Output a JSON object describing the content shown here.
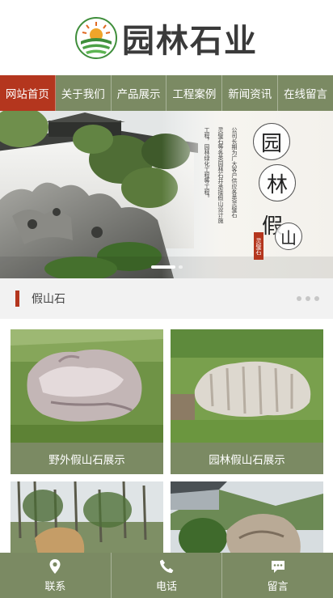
{
  "brand": {
    "name": "园林石业",
    "logo_icon": "leaf-sun-logo"
  },
  "nav": {
    "items": [
      {
        "label": "网站首页",
        "active": true
      },
      {
        "label": "关于我们",
        "active": false
      },
      {
        "label": "产品展示",
        "active": false
      },
      {
        "label": "工程案例",
        "active": false
      },
      {
        "label": "新闻资讯",
        "active": false
      },
      {
        "label": "在线留言",
        "active": false
      }
    ]
  },
  "banner": {
    "big_chars": [
      "园",
      "林",
      "假",
      "山"
    ],
    "seal": "灵璧石",
    "text_col1": "工程，园林绿化工程等工程。",
    "text_col2": "灵璧石等各类园林石并承接假山设计施",
    "text_col3": "公司长期为广大客户供应各类灵璧石",
    "slide_count": 2,
    "active_slide": 1
  },
  "section": {
    "title": "假山石"
  },
  "products": [
    {
      "caption": "野外假山石展示"
    },
    {
      "caption": "园林假山石展示"
    },
    {
      "caption": ""
    },
    {
      "caption": ""
    }
  ],
  "bottombar": {
    "items": [
      {
        "label": "联系",
        "icon": "location-pin-icon"
      },
      {
        "label": "电话",
        "icon": "phone-icon"
      },
      {
        "label": "留言",
        "icon": "message-icon"
      }
    ]
  },
  "colors": {
    "accent_green": "#7b8a63",
    "active_red": "#b4361e"
  }
}
